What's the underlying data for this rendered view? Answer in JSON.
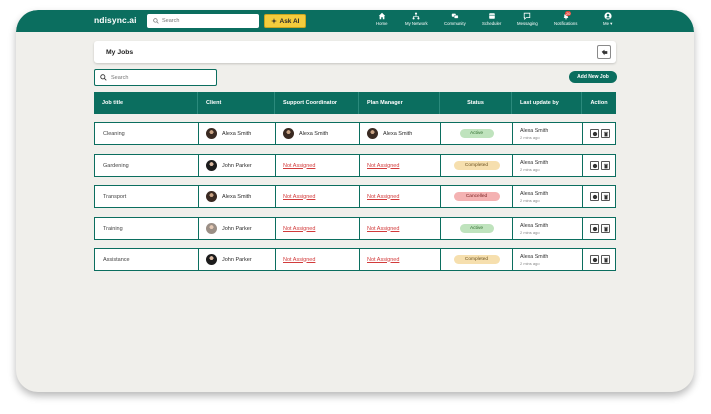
{
  "app": {
    "logo": "ndisync.ai"
  },
  "topbar": {
    "search_placeholder": "Search",
    "ask_ai_label": "Ask AI",
    "nav": [
      {
        "label": "Home",
        "icon": "home-icon"
      },
      {
        "label": "My Network",
        "icon": "network-icon"
      },
      {
        "label": "Community",
        "icon": "community-icon"
      },
      {
        "label": "Scheduler",
        "icon": "scheduler-icon"
      },
      {
        "label": "Messaging",
        "icon": "message-icon"
      },
      {
        "label": "Notifications",
        "icon": "bell-icon",
        "badge": "20"
      },
      {
        "label": "Me ▾",
        "icon": "avatar-icon"
      }
    ]
  },
  "page": {
    "title": "My Jobs",
    "search_placeholder": "Search",
    "add_button": "Add New Job"
  },
  "table": {
    "headers": [
      "Job title",
      "Client",
      "Support Coordinator",
      "Plan Manager",
      "Status",
      "Last update by",
      "Action"
    ],
    "rows": [
      {
        "job": "Cleaning",
        "client": "Alexa Smith",
        "coordinator": "Alexa Smith",
        "plan_manager": "Alexa Smith",
        "status": "Active",
        "updated_by": "Alexa Smith",
        "updated_when": "2 mins ago"
      },
      {
        "job": "Gardening",
        "client": "John Parker",
        "coordinator": "Not Assigned",
        "plan_manager": "Not Assigned",
        "status": "Completed",
        "updated_by": "Alexa Smith",
        "updated_when": "2 mins ago"
      },
      {
        "job": "Transport",
        "client": "Alexa Smith",
        "coordinator": "Not Assigned",
        "plan_manager": "Not Assigned",
        "status": "Cancelled",
        "updated_by": "Alexa Smith",
        "updated_when": "2 mins ago"
      },
      {
        "job": "Training",
        "client": "John Parker",
        "coordinator": "Not Assigned",
        "plan_manager": "Not Assigned",
        "status": "Active",
        "updated_by": "Alexa Smith",
        "updated_when": "2 mins ago"
      },
      {
        "job": "Assistance",
        "client": "John Parker",
        "coordinator": "Not Assigned",
        "plan_manager": "Not Assigned",
        "status": "Completed",
        "updated_by": "Alexa Smith",
        "updated_when": "2 mins ago"
      }
    ]
  },
  "colors": {
    "brand": "#0b6e5f",
    "ask_ai": "#f4cc3d",
    "status_active": "#bfe3bd",
    "status_completed": "#f6dfae",
    "status_cancelled": "#f4b2b2",
    "not_assigned": "#d23b3b"
  }
}
